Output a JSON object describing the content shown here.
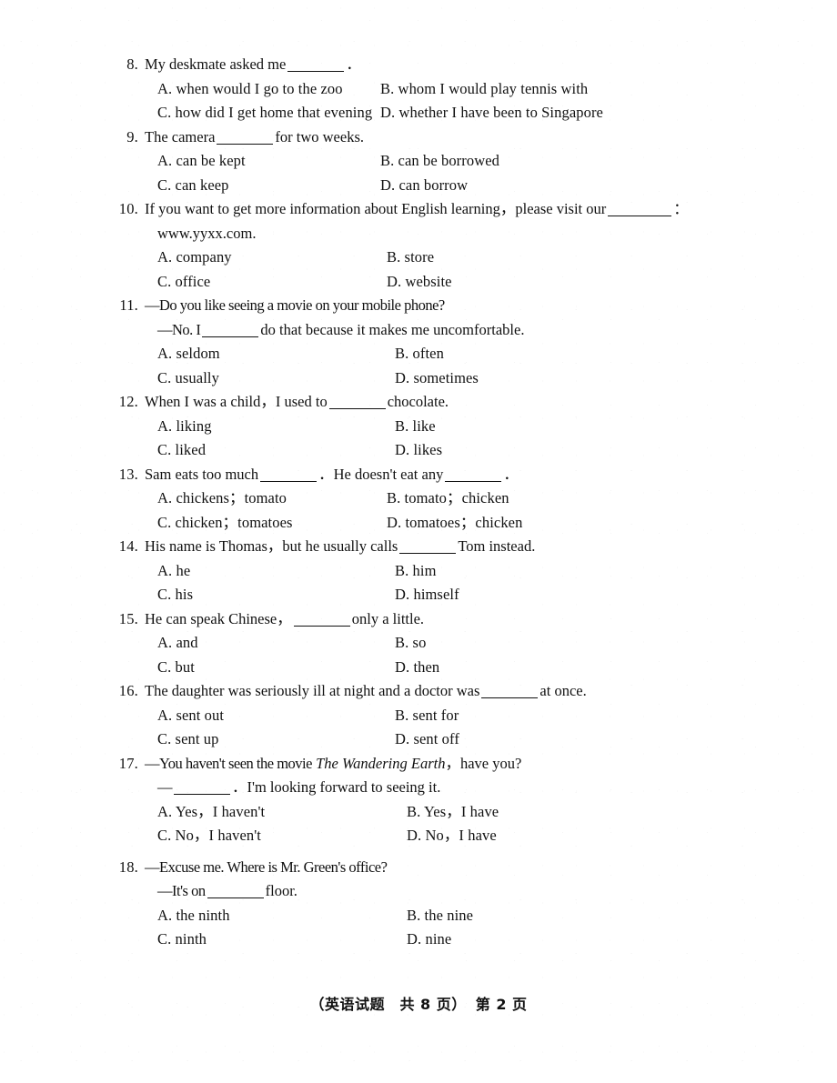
{
  "document": {
    "type": "exam-paper",
    "language": "en",
    "footer": {
      "subject_group": "（英语试题　共 8 页）",
      "page_label": "第 2 页"
    }
  },
  "questions": [
    {
      "number": "8.",
      "stem_before": "My deskmate asked me",
      "stem_after": "．",
      "continuation": "",
      "options": {
        "A": "A. when would I go to the zoo",
        "B": "B. whom I would play tennis with",
        "C": "C. how did I get home that evening",
        "D": "D. whether I have been to Singapore"
      }
    },
    {
      "number": "9.",
      "stem_before": "The camera",
      "stem_after": "for two weeks.",
      "continuation": "",
      "options": {
        "A": "A. can be kept",
        "B": "B. can be borrowed",
        "C": "C. can keep",
        "D": "D. can borrow"
      }
    },
    {
      "number": "10.",
      "stem_before": "If you want to get more information about English learning，please visit our",
      "stem_after": "：",
      "continuation": "www.yyxx.com.",
      "options": {
        "A": "A. company",
        "B": "B. store",
        "C": "C. office",
        "D": "D. website"
      }
    },
    {
      "number": "11.",
      "stem_before": "—Do you like seeing a movie on your mobile phone?",
      "stem_after": "",
      "continuation_before": "—No. I",
      "continuation_after": "do that because it makes me uncomfortable.",
      "options": {
        "A": "A. seldom",
        "B": "B. often",
        "C": "C. usually",
        "D": "D. sometimes"
      }
    },
    {
      "number": "12.",
      "stem_before": "When I was a child，I used to",
      "stem_after": "chocolate.",
      "continuation": "",
      "options": {
        "A": "A. liking",
        "B": "B. like",
        "C": "C. liked",
        "D": "D. likes"
      }
    },
    {
      "number": "13.",
      "stem_before": "Sam eats too much",
      "stem_middle": "．He doesn't eat any",
      "stem_after": "．",
      "continuation": "",
      "options": {
        "A": "A. chickens；tomato",
        "B": "B. tomato；chicken",
        "C": "C. chicken；tomatoes",
        "D": "D. tomatoes；chicken"
      }
    },
    {
      "number": "14.",
      "stem_before": "His name is Thomas，but he usually calls",
      "stem_after": "Tom instead.",
      "continuation": "",
      "options": {
        "A": "A. he",
        "B": "B. him",
        "C": "C. his",
        "D": "D. himself"
      }
    },
    {
      "number": "15.",
      "stem_before": "He can speak Chinese，",
      "stem_after": "only a little.",
      "continuation": "",
      "options": {
        "A": "A. and",
        "B": "B. so",
        "C": "C. but",
        "D": "D. then"
      }
    },
    {
      "number": "16.",
      "stem_before": "The daughter was seriously ill at night and a doctor was",
      "stem_after": "at once.",
      "continuation": "",
      "options": {
        "A": "A. sent out",
        "B": "B. sent for",
        "C": "C. sent up",
        "D": "D. sent off"
      }
    },
    {
      "number": "17.",
      "stem_before": "—You haven't seen the movie",
      "stem_italic": "The Wandering Earth",
      "stem_after": "，have you?",
      "continuation_before": "—",
      "continuation_after": "．I'm looking forward to seeing it.",
      "options": {
        "A": "A. Yes，I haven't",
        "B": "B. Yes，I have",
        "C": "C. No，I haven't",
        "D": "D. No，I have"
      }
    },
    {
      "number": "18.",
      "stem_before": "—Excuse me. Where is Mr. Green's office?",
      "stem_after": "",
      "continuation_before": "—It's on",
      "continuation_after": "floor.",
      "options": {
        "A": "A. the ninth",
        "B": "B. the nine",
        "C": "C. ninth",
        "D": "D. nine"
      }
    }
  ]
}
